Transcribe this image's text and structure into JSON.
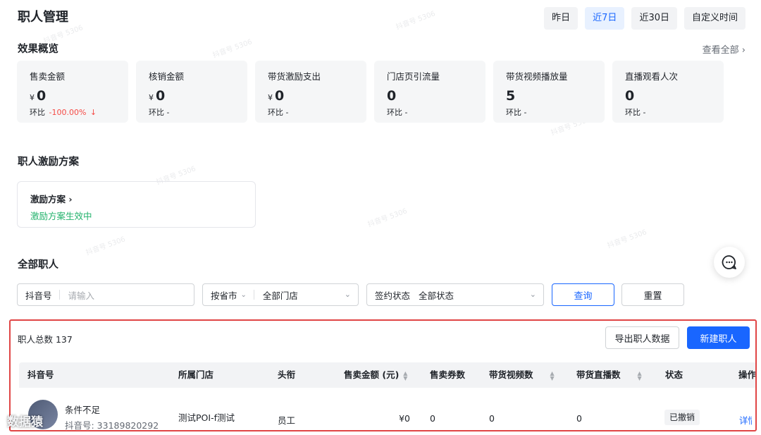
{
  "page": {
    "title": "职人管理"
  },
  "date_tabs": [
    {
      "label": "昨日",
      "active": false
    },
    {
      "label": "近7日",
      "active": true
    },
    {
      "label": "近30日",
      "active": false
    },
    {
      "label": "自定义时间",
      "active": false
    }
  ],
  "overview": {
    "title": "效果概览",
    "view_all": "查看全部 ›",
    "cards": [
      {
        "label": "售卖金额",
        "currency": "¥",
        "value": "0",
        "cmp_label": "环比",
        "cmp_value": "-100.00%",
        "down_icon": "↓"
      },
      {
        "label": "核销金额",
        "currency": "¥",
        "value": "0",
        "cmp_label": "环比",
        "cmp_value": "-"
      },
      {
        "label": "带货激励支出",
        "currency": "¥",
        "value": "0",
        "cmp_label": "环比",
        "cmp_value": "-"
      },
      {
        "label": "门店页引流量",
        "currency": "",
        "value": "0",
        "cmp_label": "环比",
        "cmp_value": "-"
      },
      {
        "label": "带货视频播放量",
        "currency": "",
        "value": "5",
        "cmp_label": "环比",
        "cmp_value": "-"
      },
      {
        "label": "直播观看人次",
        "currency": "",
        "value": "0",
        "cmp_label": "环比",
        "cmp_value": "-"
      }
    ]
  },
  "incentive": {
    "title": "职人激励方案",
    "card_title": "激励方案 ›",
    "card_status": "激励方案生效中"
  },
  "staff": {
    "title": "全部职人",
    "filters": {
      "douyin_label": "抖音号",
      "douyin_placeholder": "请输入",
      "region_label": "按省市",
      "store_value": "全部门店",
      "sign_label": "签约状态",
      "sign_value": "全部状态"
    },
    "query_button": "查询",
    "reset_button": "重置",
    "total_count": "职人总数 137",
    "export_button": "导出职人数据",
    "new_button": "新建职人",
    "columns": [
      "抖音号",
      "所属门店",
      "头衔",
      "售卖金额 (元)",
      "售卖券数",
      "带货视频数",
      "带货直播数",
      "状态",
      "操作"
    ],
    "rows": [
      {
        "name": "条件不足",
        "douyin_id": "抖音号: 33189820292",
        "store": "测试POI-f测试",
        "title": "员工",
        "sales_amount": "¥0",
        "sales_coupons": "0",
        "videos": "0",
        "lives": "0",
        "status": "已撤销",
        "action": "详情"
      }
    ]
  },
  "overlay": {
    "logo_text": "数据猿"
  },
  "watermark": {
    "text": "抖音号 5306"
  },
  "colors": {
    "primary": "#1966ff",
    "success": "#21b26b",
    "danger": "#f54a45",
    "highlight_border": "#e04545"
  }
}
